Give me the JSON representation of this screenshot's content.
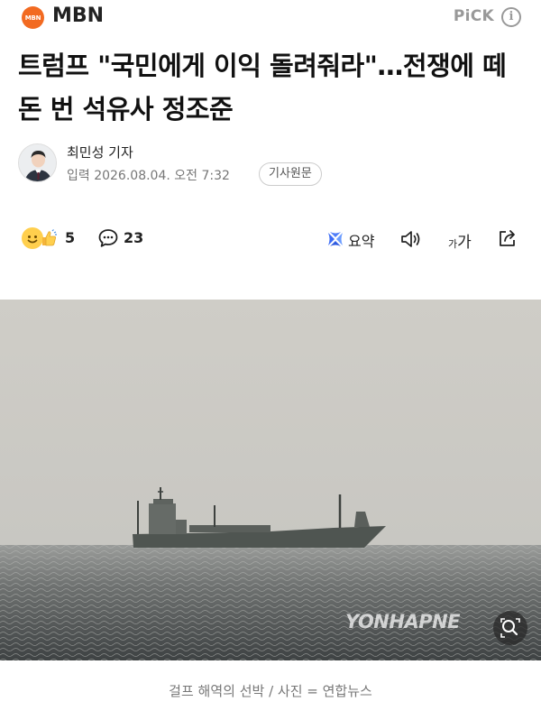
{
  "header": {
    "logo_text": "MBN",
    "brand": "MBN",
    "pick_label": "PiCK",
    "info_icon": "info-icon"
  },
  "article": {
    "headline": "트럼프 \"국민에게 이익 돌려줘라\"…전쟁에 떼돈 번 석유사 정조준",
    "reporter": "최민성 기자",
    "date": "입력 2026.08.04. 오전 7:32",
    "source_button": "기사원문"
  },
  "actions": {
    "reaction_count": "5",
    "comment_count": "23",
    "summary_label": "요약",
    "font_small": "가",
    "font_big": "가",
    "icons": [
      "reaction-emoji-icon",
      "comment-icon",
      "summary-icon",
      "speaker-icon",
      "share-icon"
    ]
  },
  "photo": {
    "watermark": "YONHAPNE",
    "caption": "걸프 해역의 선박 / 사진 = 연합뉴스"
  },
  "colors": {
    "brand_orange": "#f26a21",
    "muted_gray": "#777777",
    "summary_blue": "#3b6bf6"
  }
}
